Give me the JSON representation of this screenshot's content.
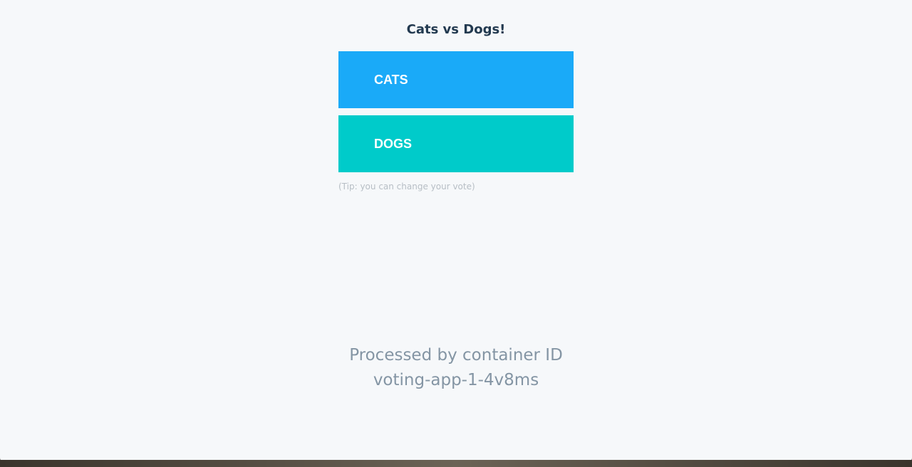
{
  "page": {
    "title": "Cats vs Dogs!",
    "tip": "(Tip: you can change your vote)"
  },
  "vote": {
    "option_a": {
      "label": "CATS",
      "color": "#1aaaf8"
    },
    "option_b": {
      "label": "DOGS",
      "color": "#00cbca"
    }
  },
  "footer": {
    "line1": "Processed by container ID",
    "line2": "voting-app-1-4v8ms"
  }
}
